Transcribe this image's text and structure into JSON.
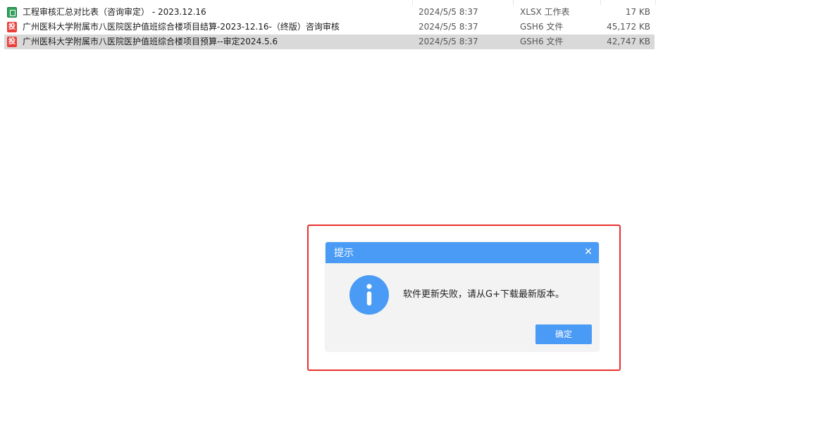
{
  "files": [
    {
      "icon": "xlsx-file-icon",
      "icon_text": "",
      "name": "工程审核汇总对比表（咨询审定） - 2023.12.16",
      "date": "2024/5/5 8:37",
      "type": "XLSX 工作表",
      "size": "17 KB"
    },
    {
      "icon": "gsh6-file-icon",
      "icon_text": "投",
      "name": "广州医科大学附属市八医院医护值班综合楼项目结算-2023-12.16-（终版）咨询审核",
      "date": "2024/5/5 8:37",
      "type": "GSH6 文件",
      "size": "45,172 KB"
    },
    {
      "icon": "gsh6-file-icon",
      "icon_text": "投",
      "name": "广州医科大学附属市八医院医护值班综合楼项目预算--审定2024.5.6",
      "date": "2024/5/5 8:37",
      "type": "GSH6 文件",
      "size": "42,747 KB"
    }
  ],
  "dialog": {
    "title": "提示",
    "close_glyph": "✕",
    "message": "软件更新失败，请从G+下载最新版本。",
    "ok_label": "确定"
  },
  "colors": {
    "dialog_header": "#4a9bf5",
    "highlight_border": "#e8302c",
    "selected_row": "#d9d9d9",
    "xlsx_icon": "#2fa35a",
    "gsh6_icon": "#e8413b"
  }
}
